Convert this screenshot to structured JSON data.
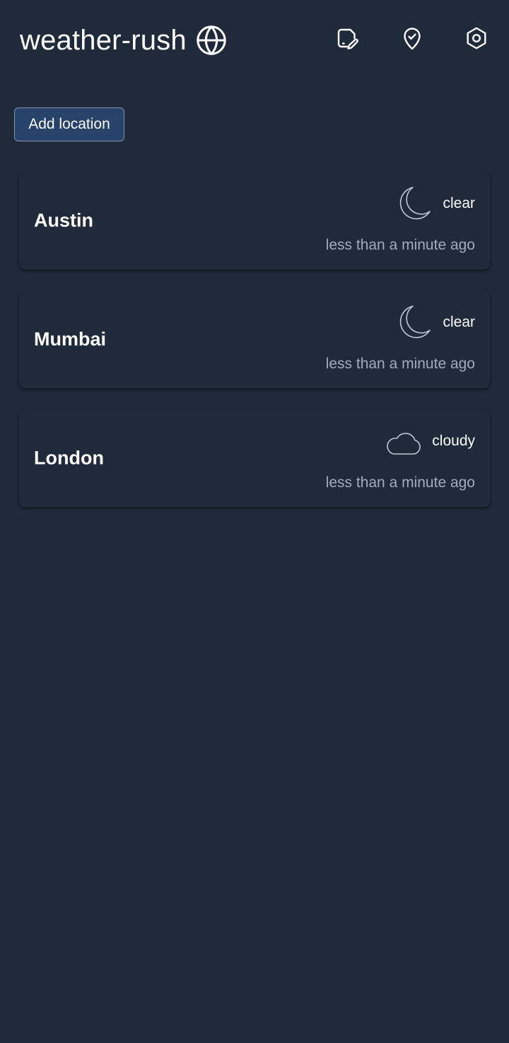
{
  "header": {
    "title": "weather-rush",
    "title_icon": "globe-icon",
    "actions": [
      {
        "name": "edit",
        "icon": "file-edit-icon"
      },
      {
        "name": "location",
        "icon": "map-pin-check-icon"
      },
      {
        "name": "settings",
        "icon": "settings-hexagon-icon"
      }
    ]
  },
  "toolbar": {
    "add_label": "Add location"
  },
  "locations": [
    {
      "name": "Austin",
      "condition": "clear",
      "condition_icon": "moon-icon",
      "updated": "less than a minute ago"
    },
    {
      "name": "Mumbai",
      "condition": "clear",
      "condition_icon": "moon-icon",
      "updated": "less than a minute ago"
    },
    {
      "name": "London",
      "condition": "cloudy",
      "condition_icon": "cloud-icon",
      "updated": "less than a minute ago"
    }
  ],
  "colors": {
    "background": "#1f2a3b",
    "button_bg": "#27436a",
    "button_border": "#7d94b3",
    "muted_text": "#a4acb8",
    "text": "#ffffff"
  }
}
